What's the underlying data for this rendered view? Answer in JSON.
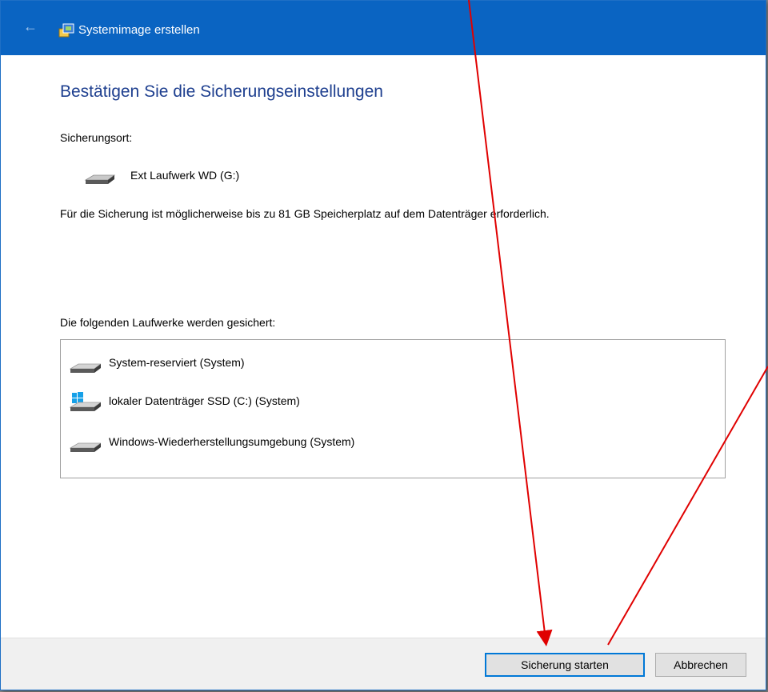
{
  "window": {
    "title": "Systemimage erstellen"
  },
  "page": {
    "heading": "Bestätigen Sie die Sicherungseinstellungen",
    "location_label": "Sicherungsort:",
    "location_drive": "Ext Laufwerk WD (G:)",
    "space_note": "Für die Sicherung ist möglicherweise bis zu 81 GB Speicherplatz auf dem Datenträger erforderlich.",
    "drives_label": "Die folgenden Laufwerke werden gesichert:",
    "drives": [
      {
        "label": "System-reserviert (System)",
        "icon": "hard-drive-icon"
      },
      {
        "label": "lokaler Datenträger SSD (C:) (System)",
        "icon": "windows-drive-icon"
      },
      {
        "label": "Windows-Wiederherstellungsumgebung (System)",
        "icon": "hard-drive-icon"
      }
    ]
  },
  "footer": {
    "start_button": "Sicherung starten",
    "cancel_button": "Abbrechen"
  },
  "colors": {
    "titlebar": "#0a64c2",
    "heading": "#1e3f8f",
    "annotation_arrow": "#e00000"
  }
}
